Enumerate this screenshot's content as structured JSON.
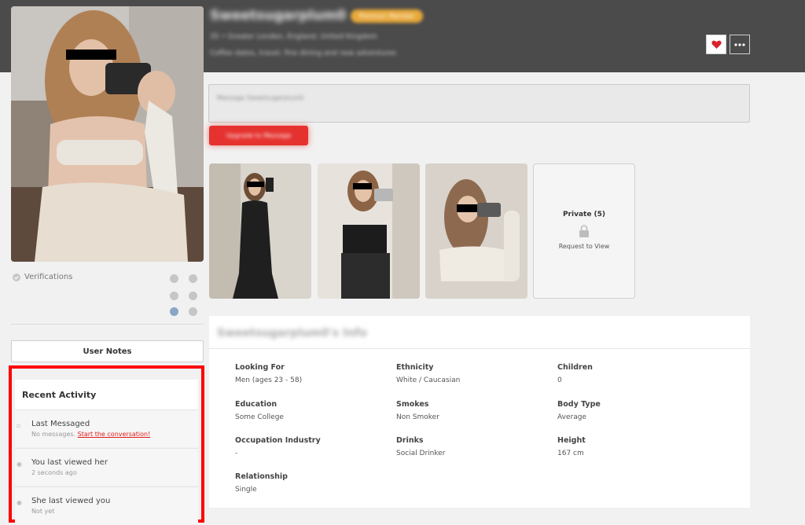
{
  "header": {
    "username_blurred": "Sweetsugarplum0",
    "badge_blurred": "Premium Member",
    "line1_blurred": "35 • Greater London, England, United Kingdom",
    "line2_blurred": "Coffee dates, travel, fine dining and new adventures",
    "favorite_icon": "heart-icon",
    "more_icon": "more-dots-icon"
  },
  "photos": {
    "count_public": 3,
    "private_label": "Private (5)",
    "private_action": "Request to View",
    "lock_icon": "lock-icon"
  },
  "verifications": {
    "label": "Verifications",
    "icons": [
      "check-icon",
      "user-icon",
      "phone-icon",
      "facebook-icon",
      "instagram-icon",
      "linkedin-icon"
    ]
  },
  "user_notes_label": "User Notes",
  "recent_activity": {
    "title": "Recent Activity",
    "items": [
      {
        "title": "Last Messaged",
        "sub": "No messages.",
        "link": "Start the conversation!"
      },
      {
        "title": "You last viewed her",
        "sub": "2 seconds ago"
      },
      {
        "title": "She last viewed you",
        "sub": "Not yet"
      }
    ]
  },
  "message": {
    "placeholder_blurred": "Message Sweetsugarplum0",
    "upgrade_blurred": "Upgrade to Message"
  },
  "info": {
    "title_blurred": "Sweetsugarplum0's Info",
    "fields": [
      {
        "label": "Looking For",
        "value": "Men (ages 23 - 58)"
      },
      {
        "label": "Ethnicity",
        "value": "White / Caucasian"
      },
      {
        "label": "Children",
        "value": "0"
      },
      {
        "label": "Education",
        "value": "Some College"
      },
      {
        "label": "Smokes",
        "value": "Non Smoker"
      },
      {
        "label": "Body Type",
        "value": "Average"
      },
      {
        "label": "Occupation Industry",
        "value": "-"
      },
      {
        "label": "Drinks",
        "value": "Social Drinker"
      },
      {
        "label": "Height",
        "value": "167 cm"
      },
      {
        "label": "Relationship",
        "value": "Single"
      }
    ]
  },
  "colors": {
    "topbar": "#4b4b4b",
    "accent_red": "#e5322f",
    "highlight_frame": "#ff0000",
    "badge": "#e8a93b"
  }
}
